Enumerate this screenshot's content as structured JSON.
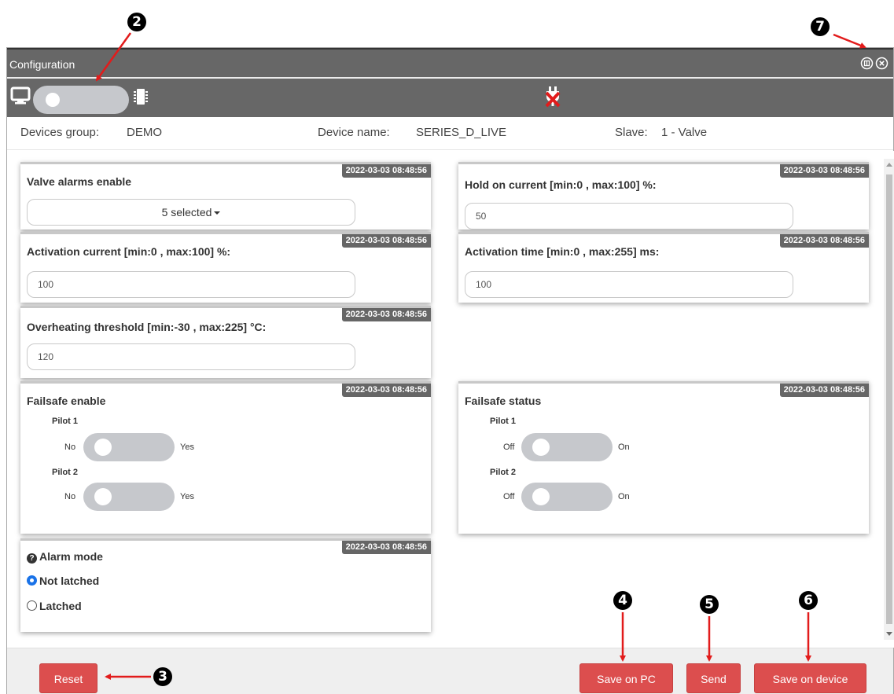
{
  "annotations": {
    "n2": "2",
    "n3": "3",
    "n4": "4",
    "n5": "5",
    "n6": "6",
    "n7": "7"
  },
  "window": {
    "title": "Configuration"
  },
  "infobar": {
    "group_label": "Devices group:",
    "group_value": "DEMO",
    "device_label": "Device name:",
    "device_value": "SERIES_D_LIVE",
    "slave_label": "Slave:",
    "slave_value": "1 - Valve"
  },
  "cards": {
    "valve_alarms": {
      "label": "Valve alarms enable",
      "timestamp": "2022-03-03 08:48:56",
      "value": "5 selected"
    },
    "hold_current": {
      "label": "Hold on current [min:0 , max:100] %:",
      "timestamp": "2022-03-03 08:48:56",
      "value": "50"
    },
    "activation_current": {
      "label": "Activation current [min:0 , max:100] %:",
      "timestamp": "2022-03-03 08:48:56",
      "value": "100"
    },
    "activation_time": {
      "label": "Activation time [min:0 , max:255] ms:",
      "timestamp": "2022-03-03 08:48:56",
      "value": "100"
    },
    "overheating": {
      "label": "Overheating threshold [min:-30 , max:225] °C:",
      "timestamp": "2022-03-03 08:48:56",
      "value": "120"
    },
    "failsafe_enable": {
      "label": "Failsafe enable",
      "timestamp": "2022-03-03 08:48:56",
      "pilot1": "Pilot 1",
      "pilot2": "Pilot 2",
      "off_label": "No",
      "on_label": "Yes"
    },
    "failsafe_status": {
      "label": "Failsafe status",
      "timestamp": "2022-03-03 08:48:56",
      "pilot1": "Pilot 1",
      "pilot2": "Pilot 2",
      "off_label": "Off",
      "on_label": "On"
    },
    "alarm_mode": {
      "label": "Alarm mode",
      "timestamp": "2022-03-03 08:48:56",
      "options": [
        "Not latched",
        "Latched"
      ],
      "selected": "Not latched"
    }
  },
  "footer": {
    "reset": "Reset",
    "save_pc": "Save on PC",
    "send": "Send",
    "save_device": "Save on device"
  },
  "colors": {
    "titlebar": "#676767",
    "button": "#dc4e4e",
    "toggle": "#c6c8cc",
    "annotation_arrow": "#e21b1b"
  },
  "icons": [
    "monitor-icon",
    "chip-icon",
    "plug-disconnected-icon",
    "pin-icon",
    "close-icon",
    "help-icon",
    "caret-down-icon"
  ]
}
